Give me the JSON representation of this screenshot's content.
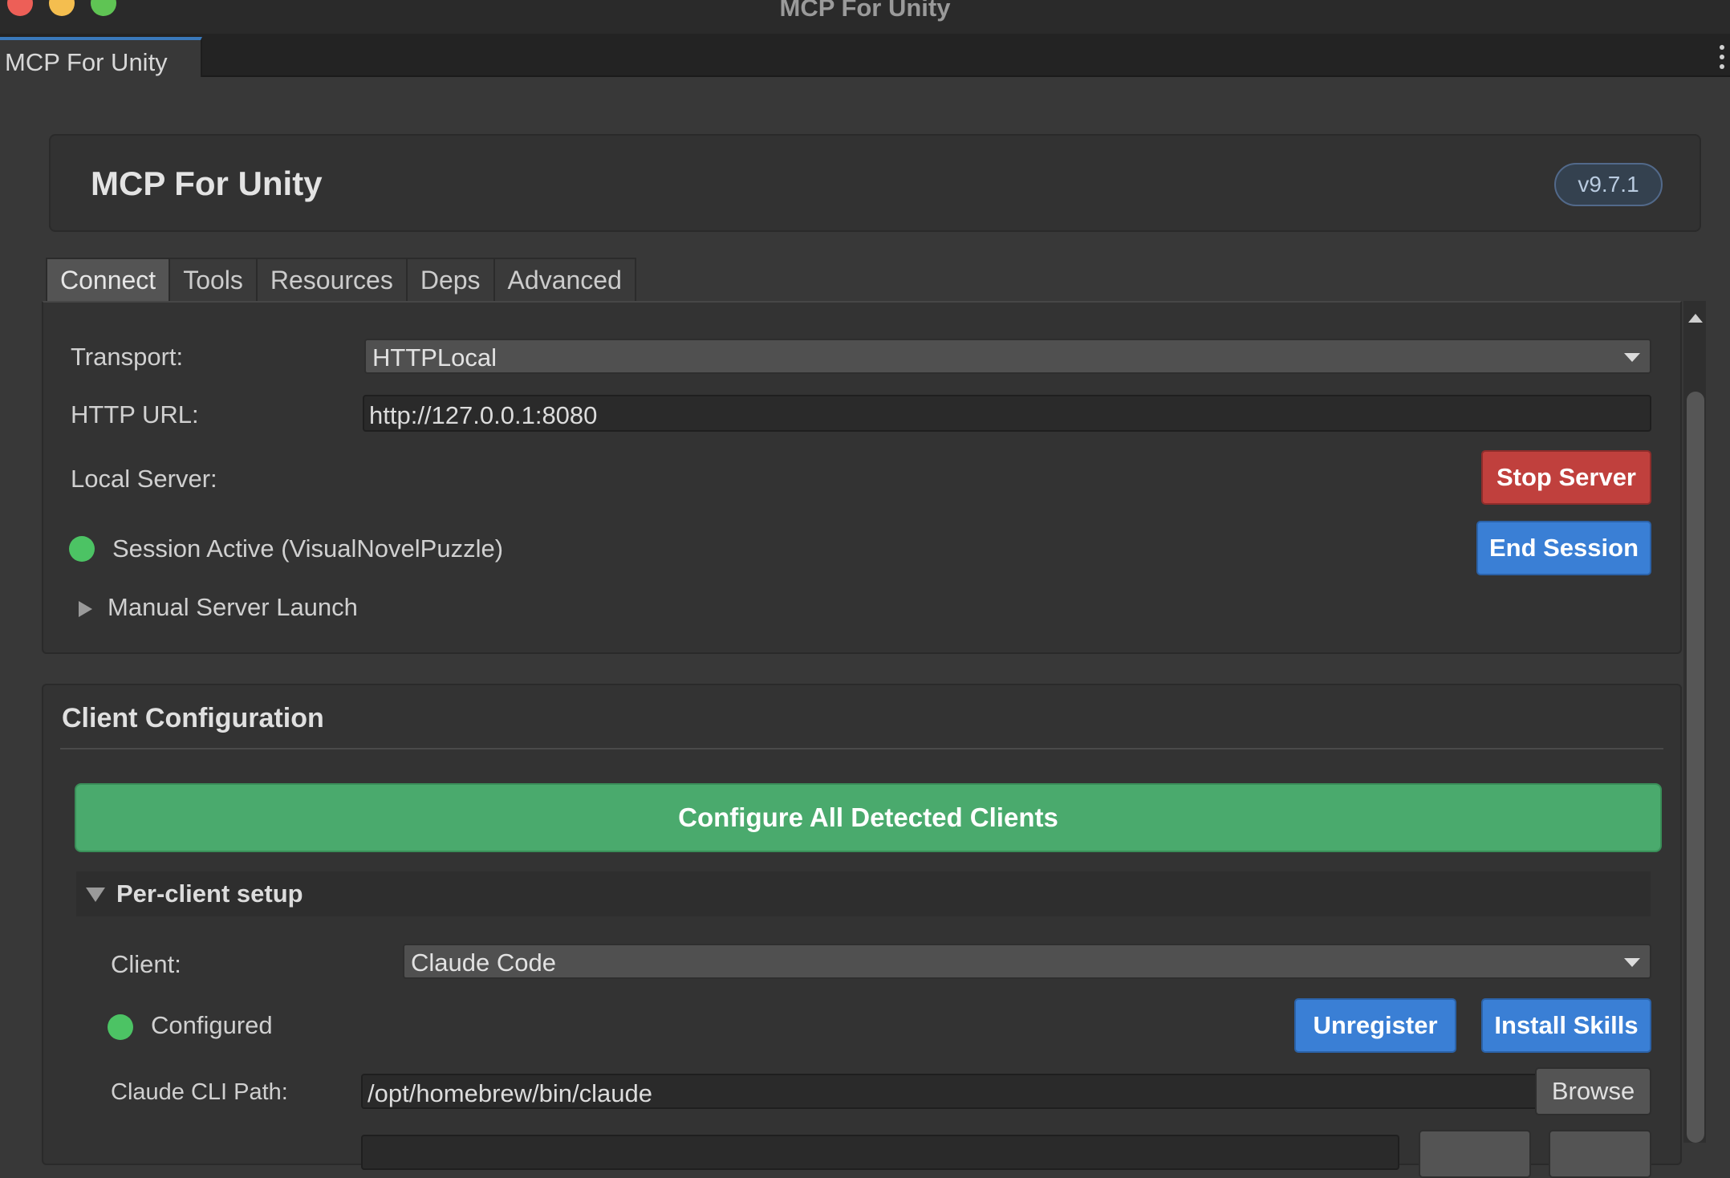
{
  "window": {
    "title": "MCP For Unity",
    "tab_label": "MCP For Unity"
  },
  "header": {
    "title": "MCP For Unity",
    "version": "v9.7.1"
  },
  "tabs": [
    {
      "label": "Connect",
      "active": true
    },
    {
      "label": "Tools",
      "active": false
    },
    {
      "label": "Resources",
      "active": false
    },
    {
      "label": "Deps",
      "active": false
    },
    {
      "label": "Advanced",
      "active": false
    }
  ],
  "connect": {
    "transport_label": "Transport:",
    "transport_value": "HTTPLocal",
    "http_url_label": "HTTP URL:",
    "http_url_value": "http://127.0.0.1:8080",
    "local_server_label": "Local Server:",
    "stop_server_label": "Stop Server",
    "session_status": "Session Active (VisualNovelPuzzle)",
    "end_session_label": "End Session",
    "manual_launch_label": "Manual Server Launch"
  },
  "client_config": {
    "title": "Client Configuration",
    "configure_all_label": "Configure All Detected Clients",
    "per_client_label": "Per-client setup",
    "client_label": "Client:",
    "client_value": "Claude Code",
    "status": "Configured",
    "unregister_label": "Unregister",
    "install_skills_label": "Install Skills",
    "cli_path_label": "Claude CLI Path:",
    "cli_path_value": "/opt/homebrew/bin/claude",
    "browse_label": "Browse"
  },
  "colors": {
    "accent_blue": "#3a7fd5",
    "danger_red": "#c0403d",
    "success_green": "#4aaa6d",
    "status_dot": "#4cc364"
  }
}
